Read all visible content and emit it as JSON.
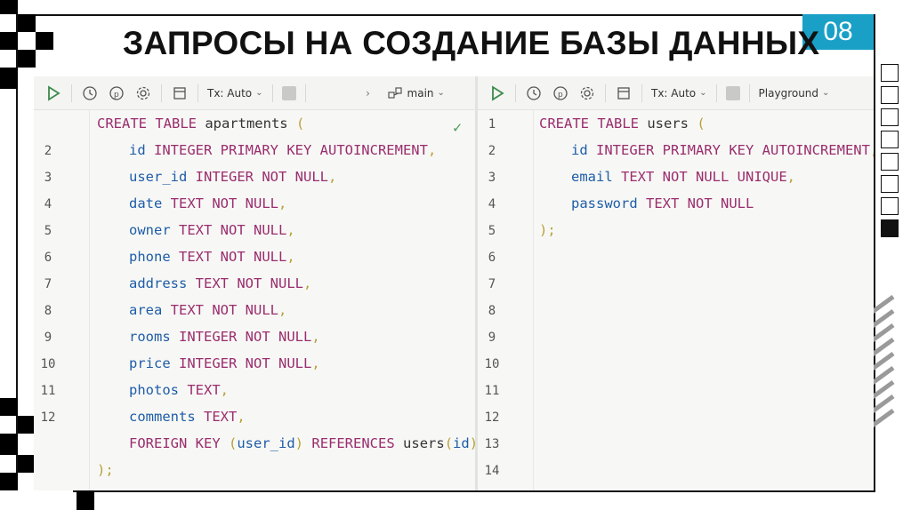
{
  "slide": {
    "title": "ЗАПРОСЫ НА СОЗДАНИЕ БАЗЫ ДАННЫХ",
    "page_number": "08",
    "badge_color": "#1aa0c7"
  },
  "left_editor": {
    "toolbar": {
      "tx_label": "Tx: Auto",
      "branch_label": "main"
    },
    "line_numbers": [
      "",
      "2",
      "3",
      "4",
      "5",
      "6",
      "7",
      "8",
      "9",
      "10",
      "11",
      "12",
      "",
      ""
    ],
    "code": [
      {
        "kw": "CREATE TABLE",
        "rest": " apartments ",
        "punc": "("
      },
      {
        "ident": "id",
        "kw": "INTEGER PRIMARY KEY AUTOINCREMENT",
        "punc": ","
      },
      {
        "ident": "user_id",
        "kw": "INTEGER NOT NULL",
        "punc": ","
      },
      {
        "ident": "date",
        "kw": "TEXT NOT NULL",
        "punc": ","
      },
      {
        "ident": "owner",
        "kw": "TEXT NOT NULL",
        "punc": ","
      },
      {
        "ident": "phone",
        "kw": "TEXT NOT NULL",
        "punc": ","
      },
      {
        "ident": "address",
        "kw": "TEXT NOT NULL",
        "punc": ","
      },
      {
        "ident": "area",
        "kw": "TEXT NOT NULL",
        "punc": ","
      },
      {
        "ident": "rooms",
        "kw": "INTEGER NOT NULL",
        "punc": ","
      },
      {
        "ident": "price",
        "kw": "INTEGER NOT NULL",
        "punc": ","
      },
      {
        "ident": "photos",
        "kw": "TEXT",
        "punc": ","
      },
      {
        "ident": "comments",
        "kw": "TEXT",
        "punc": ","
      },
      {
        "fk_kw": "FOREIGN KEY",
        "fk_open": "(",
        "fk_col": "user_id",
        "fk_close": ")",
        "ref_kw": "REFERENCES",
        "ref_table": "users",
        "ref_open": "(",
        "ref_col": "id",
        "ref_close": ")"
      },
      {
        "close": ");"
      }
    ]
  },
  "right_editor": {
    "toolbar": {
      "tx_label": "Tx: Auto",
      "target_label": "Playground"
    },
    "line_numbers": [
      "1",
      "2",
      "3",
      "4",
      "5",
      "6",
      "7",
      "8",
      "9",
      "10",
      "11",
      "12",
      "13",
      "14"
    ],
    "code": [
      {
        "kw": "CREATE TABLE",
        "rest": " users ",
        "punc": "("
      },
      {
        "ident": "id",
        "kw": "INTEGER PRIMARY KEY AUTOINCREMENT",
        "punc": ","
      },
      {
        "ident": "email",
        "kw": "TEXT NOT NULL UNIQUE",
        "punc": ","
      },
      {
        "ident": "password",
        "kw": "TEXT NOT NULL",
        "punc": ""
      },
      {
        "close": ");"
      }
    ]
  }
}
